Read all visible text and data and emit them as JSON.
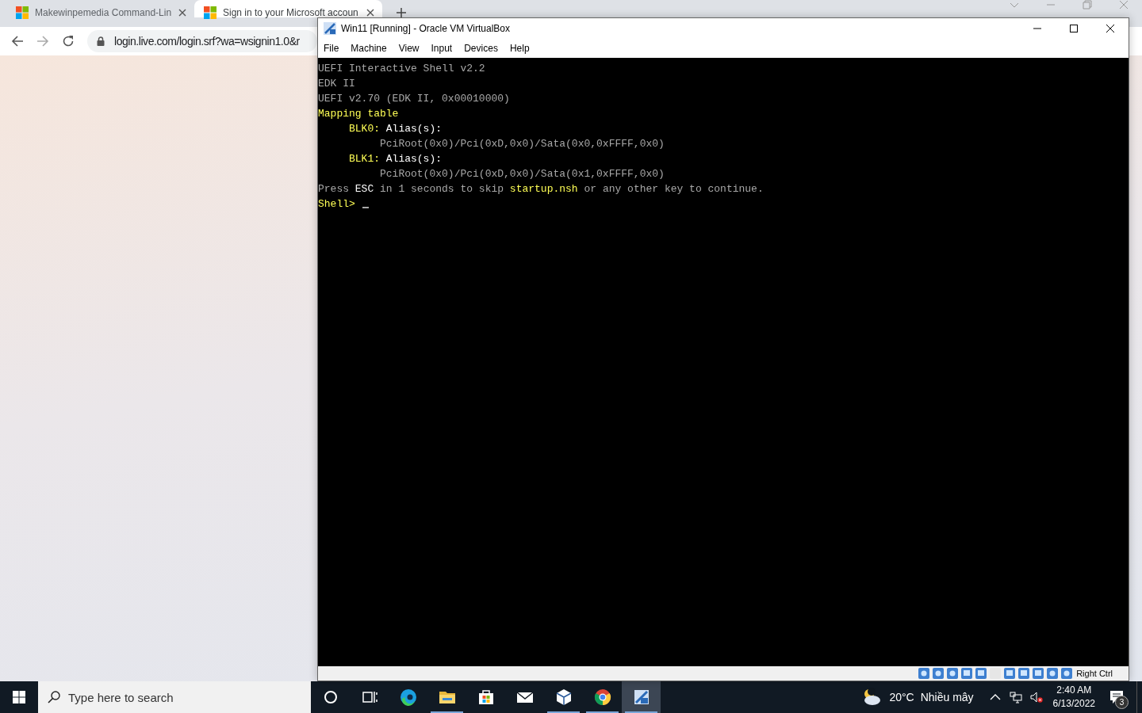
{
  "browser": {
    "tabs": [
      {
        "title": "Makewinpemedia Command-Lin",
        "selected": false
      },
      {
        "title": "Sign in to your Microsoft accoun",
        "selected": true
      }
    ],
    "address": "login.live.com/login.srf?wa=wsignin1.0&r"
  },
  "vm_window": {
    "title": "Win11 [Running] - Oracle VM VirtualBox",
    "menu": [
      "File",
      "Machine",
      "View",
      "Input",
      "Devices",
      "Help"
    ],
    "console": {
      "lines": [
        {
          "segments": [
            {
              "text": "UEFI Interactive Shell v2.2",
              "kind": "normal"
            }
          ]
        },
        {
          "segments": [
            {
              "text": "EDK II",
              "kind": "normal"
            }
          ]
        },
        {
          "segments": [
            {
              "text": "UEFI v2.70 (EDK II, 0x00010000)",
              "kind": "normal"
            }
          ]
        },
        {
          "segments": [
            {
              "text": "Mapping table",
              "kind": "yellow"
            }
          ]
        },
        {
          "segments": [
            {
              "text": "     BLK0:",
              "kind": "yellow"
            },
            {
              "text": " Alias(s):",
              "kind": "bright"
            }
          ]
        },
        {
          "segments": [
            {
              "text": "          PciRoot(0x0)/Pci(0xD,0x0)/Sata(0x0,0xFFFF,0x0)",
              "kind": "normal"
            }
          ]
        },
        {
          "segments": [
            {
              "text": "     BLK1:",
              "kind": "yellow"
            },
            {
              "text": " Alias(s):",
              "kind": "bright"
            }
          ]
        },
        {
          "segments": [
            {
              "text": "          PciRoot(0x0)/Pci(0xD,0x0)/Sata(0x1,0xFFFF,0x0)",
              "kind": "normal"
            }
          ]
        },
        {
          "segments": [
            {
              "text": "Press ",
              "kind": "normal"
            },
            {
              "text": "ESC",
              "kind": "bright"
            },
            {
              "text": " in 1 seconds to skip ",
              "kind": "normal"
            },
            {
              "text": "startup.nsh",
              "kind": "yellow"
            },
            {
              "text": " or any other key to continue.",
              "kind": "normal"
            }
          ]
        },
        {
          "segments": [
            {
              "text": "Shell> ",
              "kind": "yellow"
            }
          ],
          "cursor": true
        }
      ]
    },
    "status_bar": {
      "host_key": "Right Ctrl"
    }
  },
  "taskbar": {
    "search": {
      "placeholder": "Type here to search"
    },
    "apps": [
      {
        "kind": "cortana",
        "running": false,
        "selected": false
      },
      {
        "kind": "task-view",
        "running": false,
        "selected": false
      },
      {
        "kind": "edge",
        "running": false,
        "selected": false
      },
      {
        "kind": "explorer",
        "running": true,
        "selected": false
      },
      {
        "kind": "store",
        "running": false,
        "selected": false
      },
      {
        "kind": "mail",
        "running": false,
        "selected": false
      },
      {
        "kind": "virtualbox",
        "running": true,
        "selected": false
      },
      {
        "kind": "chrome",
        "running": true,
        "selected": false
      },
      {
        "kind": "vm",
        "running": true,
        "selected": true
      }
    ],
    "weather": {
      "temperature": "20°C",
      "condition": "Nhiều mây"
    },
    "clock": {
      "time": "2:40 AM",
      "date": "6/13/2022"
    },
    "notifications": {
      "count": "3"
    }
  }
}
